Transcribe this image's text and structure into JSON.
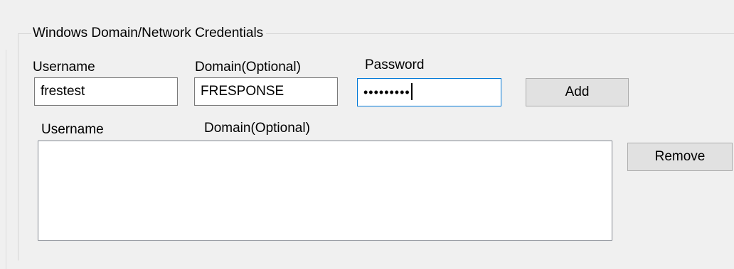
{
  "group": {
    "title": "Windows Domain/Network Credentials"
  },
  "form": {
    "username_label": "Username",
    "domain_label": "Domain(Optional)",
    "password_label": "Password",
    "username_value": "frestest",
    "domain_value": "FRESPONSE",
    "password_masked": "•••••••••",
    "add_label": "Add"
  },
  "list": {
    "username_header": "Username",
    "domain_header": "Domain(Optional)",
    "items": [],
    "remove_label": "Remove"
  }
}
